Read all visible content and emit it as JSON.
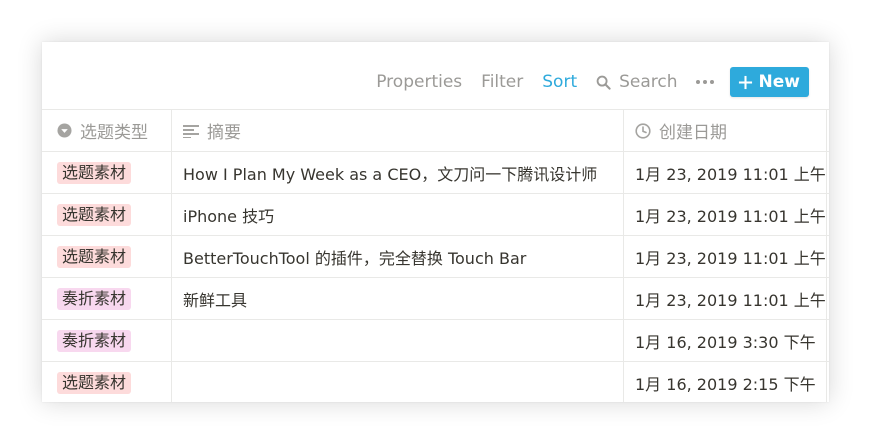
{
  "toolbar": {
    "properties": "Properties",
    "filter": "Filter",
    "sort": "Sort",
    "search": "Search",
    "new": "New"
  },
  "columns": {
    "type": "选题类型",
    "summary": "摘要",
    "created": "创建日期"
  },
  "rows": [
    {
      "tag": "选题素材",
      "tag_color": "#fddbdb",
      "summary": "How I Plan My Week as a CEO，文刀问一下腾讯设计师",
      "created": "1月 23, 2019 11:01 上午"
    },
    {
      "tag": "选题素材",
      "tag_color": "#fddbdb",
      "summary": "iPhone 技巧",
      "created": "1月 23, 2019 11:01 上午"
    },
    {
      "tag": "选题素材",
      "tag_color": "#fddbdb",
      "summary": "BetterTouchTool 的插件，完全替换 Touch Bar",
      "created": "1月 23, 2019 11:01 上午"
    },
    {
      "tag": "奏折素材",
      "tag_color": "#f8d8ef",
      "summary": "新鲜工具",
      "created": "1月 23, 2019 11:01 上午"
    },
    {
      "tag": "奏折素材",
      "tag_color": "#f8d8ef",
      "summary": "",
      "created": "1月 16, 2019 3:30 下午"
    },
    {
      "tag": "选题素材",
      "tag_color": "#fddbdb",
      "summary": "",
      "created": "1月 16, 2019 2:15 下午"
    }
  ],
  "colors": {
    "accent": "#2eaadc",
    "muted_text": "#9b9a97",
    "tag_pink": "#fddbdb",
    "tag_purple": "#f8d8ef"
  }
}
